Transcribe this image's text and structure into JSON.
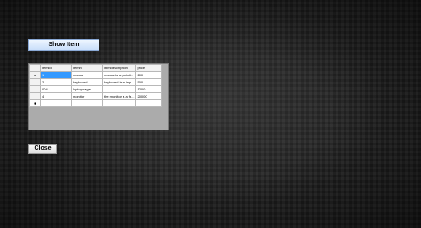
{
  "buttons": {
    "show_item": "Show Item",
    "close": "Close"
  },
  "grid": {
    "columns": [
      "itemid",
      "itemn",
      "itemdescription",
      "price"
    ],
    "rows": [
      {
        "marker": "▸",
        "cells": [
          "1",
          "mouse",
          "mouse is a pointi...",
          "200"
        ]
      },
      {
        "marker": "",
        "cells": [
          "2",
          "keyboard",
          "keyboard is a inp...",
          "500"
        ]
      },
      {
        "marker": "",
        "cells": [
          "004",
          "laptophage",
          "",
          "1200"
        ]
      },
      {
        "marker": "",
        "cells": [
          "4",
          "monitor",
          "the monitor a a fe...",
          "20000"
        ]
      }
    ],
    "new_row_marker": "✱"
  },
  "colors": {
    "selection": "#3399ff",
    "grid_background": "#ababab",
    "show_button": "#c9defa"
  }
}
